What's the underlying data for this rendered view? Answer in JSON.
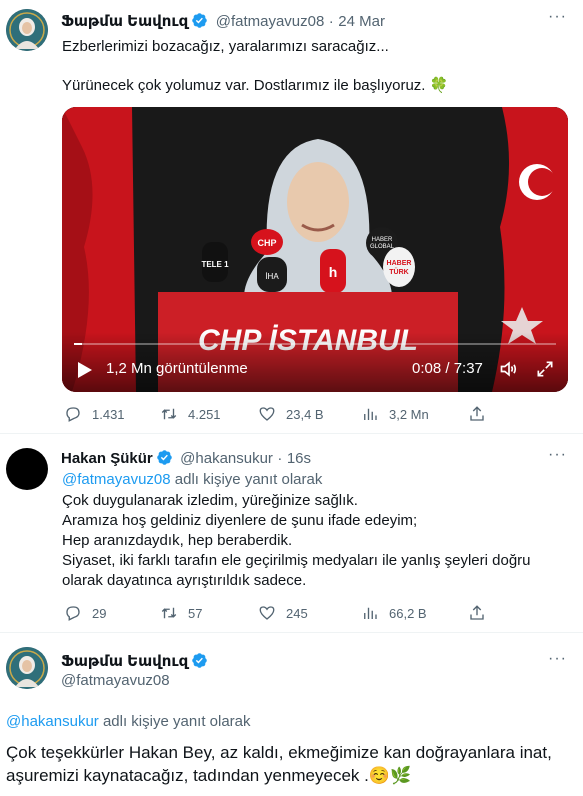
{
  "tweet1": {
    "display_name": "Ֆաթմա Եավուզ",
    "handle": "@fatmayavuz08",
    "separator": "·",
    "date": "24 Mar",
    "line1": "Ezberlerimizi bozacağız, yaralarımızı saracağız...",
    "line2": "Yürünecek çok yolumuz var. Dostlarımız ile başlıyoruz. 🍀",
    "video": {
      "views": "1,2 Mn görüntülenme",
      "time": "0:08 / 7:37",
      "podium_text": "CHP İSTANBUL",
      "mic_labels": [
        "TELE 1",
        "CHP",
        "İHA",
        "HABER GLOBAL",
        "HABER TÜRK"
      ]
    },
    "stats": {
      "replies": "1.431",
      "retweets": "4.251",
      "likes": "23,4 B",
      "views": "3,2 Mn"
    }
  },
  "tweet2": {
    "display_name": "Hakan Şükür",
    "handle": "@hakansukur",
    "separator": "·",
    "date": "16s",
    "reply_to_handle": "@fatmayavuz08",
    "reply_to_suffix": " adlı kişiye yanıt olarak",
    "lines": [
      "Çok duygulanarak izledim, yüreğinize sağlık.",
      "Aramıza hoş geldiniz diyenlere de şunu ifade edeyim;",
      "Hep aranızdaydık, hep beraberdik.",
      "Siyaset, iki farklı tarafın ele geçirilmiş medyaları ile yanlış şeyleri doğru",
      "olarak dayatınca ayrıştırıldık sadece."
    ],
    "stats": {
      "replies": "29",
      "retweets": "57",
      "likes": "245",
      "views": "66,2 B"
    }
  },
  "tweet3": {
    "display_name": "Ֆաթմա Եավուզ",
    "handle": "@fatmayavuz08",
    "reply_to_handle": "@hakansukur",
    "reply_to_suffix": " adlı kişiye yanıt olarak",
    "line1": "Çok teşekkürler Hakan Bey, az kaldı, ekmeğimize kan doğrayanlara inat,",
    "line2": "aşuremizi kaynatacağız, tadından yenmeyecek .☺️🌿"
  },
  "more_glyph": "···",
  "colors": {
    "accent": "#1d9bf0",
    "muted": "#536471",
    "divider": "#eff3f4"
  }
}
